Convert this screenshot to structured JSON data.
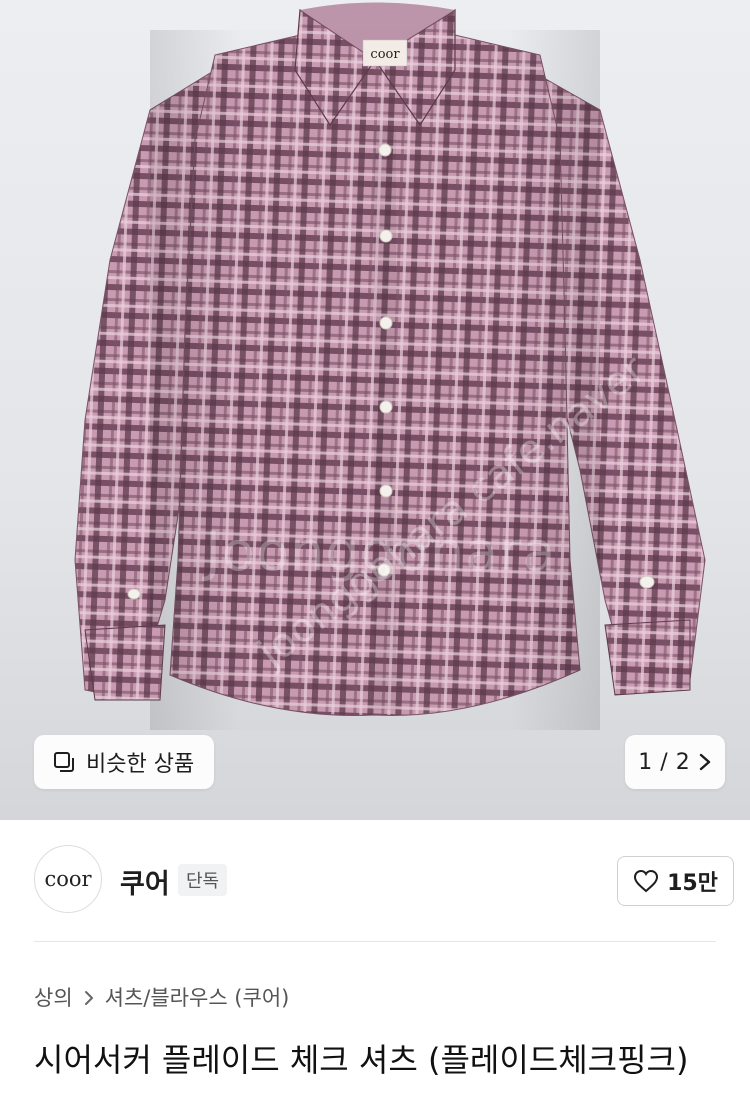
{
  "product_image": {
    "tag_label": "coor",
    "watermark_main": "Joonggonara",
    "watermark_diag": "joonggonara cafe.naver"
  },
  "similar": {
    "label": "비슷한 상품",
    "icon": "copy-icon"
  },
  "pager": {
    "current": "1",
    "separator": " / ",
    "total": "2",
    "icon": "chevron-right-icon"
  },
  "brand": {
    "logo_text": "coor",
    "name": "쿠어",
    "badge": "단독"
  },
  "like": {
    "count": "15만",
    "icon": "heart-outline-icon"
  },
  "breadcrumb": {
    "items": [
      "상의",
      "셔츠/블라우스 (쿠어)"
    ],
    "separator_icon": "chevron-right-icon"
  },
  "product": {
    "title": "시어서커 플레이드 체크 셔츠 (플레이드체크핑크)"
  },
  "colors": {
    "shirt_base": "#b9869f",
    "shirt_dark": "#5d3a4c",
    "shirt_light": "#e6c4d6",
    "text_primary": "#1e1e1e",
    "text_secondary": "#555555"
  }
}
